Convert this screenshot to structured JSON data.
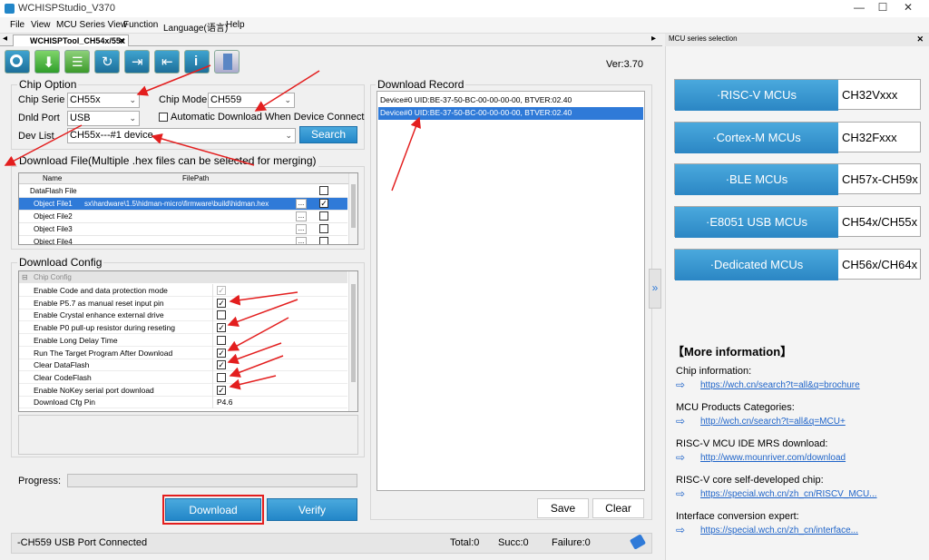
{
  "app": {
    "title": "WCHISPStudio_V370"
  },
  "window_controls": {
    "minimize": "—",
    "maximize": "☐",
    "close": "✕"
  },
  "menu": [
    "File",
    "View",
    "MCU Series View",
    "Function",
    "Language(语言)",
    "Help"
  ],
  "tabs": {
    "active": "WCHISPTool_CH54x/55x",
    "close": "✕",
    "nav_left": "◂",
    "nav_right": "▸"
  },
  "toolbar": {
    "icons": [
      "search-icon",
      "download-icon",
      "checklist-icon",
      "refresh-icon",
      "import-icon",
      "export-icon",
      "info-icon",
      "book-icon"
    ],
    "version": "Ver:3.70"
  },
  "chip_option": {
    "title": "Chip Option",
    "chip_serie_label": "Chip Serie",
    "chip_serie_value": "CH55x",
    "chip_model_label": "Chip Model",
    "chip_model_value": "CH559",
    "dnld_port_label": "Dnld Port",
    "dnld_port_value": "USB",
    "auto_download_label": "Automatic Download When Device Connect",
    "dev_list_label": "Dev List",
    "dev_list_value": "CH55x---#1 device",
    "search_button": "Search"
  },
  "download_file": {
    "title": "Download File(Multiple .hex files can be selected for merging)",
    "headers": [
      "Name",
      "FilePath"
    ],
    "rows": [
      {
        "name": "DataFlash File",
        "path": "",
        "checked": false,
        "browse": false,
        "selected": false
      },
      {
        "name": "Object File1",
        "path": "sx\\hardware\\1.5\\hidman-micro\\firmware\\build\\hidman.hex",
        "checked": true,
        "browse": true,
        "selected": true
      },
      {
        "name": "Object File2",
        "path": "",
        "checked": false,
        "browse": true,
        "selected": false
      },
      {
        "name": "Object File3",
        "path": "",
        "checked": false,
        "browse": true,
        "selected": false
      },
      {
        "name": "Object File4",
        "path": "",
        "checked": false,
        "browse": true,
        "selected": false
      }
    ],
    "browse_label": "..."
  },
  "download_config": {
    "title": "Download Config",
    "section": "Chip Config",
    "items": [
      {
        "label": "Enable Code and data protection mode",
        "value": "✓",
        "type": "check-disabled"
      },
      {
        "label": "Enable P5.7 as manual reset input pin",
        "value": "✓",
        "type": "check"
      },
      {
        "label": "Enable Crystal enhance external drive",
        "value": "",
        "type": "check"
      },
      {
        "label": "Enable P0 pull-up resistor during reseting",
        "value": "✓",
        "type": "check"
      },
      {
        "label": "Enable Long Delay Time",
        "value": "",
        "type": "check"
      },
      {
        "label": "Run The Target Program After Download",
        "value": "✓",
        "type": "check"
      },
      {
        "label": "Clear DataFlash",
        "value": "✓",
        "type": "check"
      },
      {
        "label": "Clear CodeFlash",
        "value": "",
        "type": "check"
      },
      {
        "label": "Enable NoKey serial port download",
        "value": "✓",
        "type": "check"
      },
      {
        "label": "Download Cfg Pin",
        "value": "P4.6",
        "type": "text"
      }
    ]
  },
  "progress": {
    "label": "Progress:",
    "percent": 0
  },
  "actions": {
    "download": "Download",
    "verify": "Verify"
  },
  "download_record": {
    "title": "Download Record",
    "lines": [
      {
        "text": "Device#0  UID:BE-37-50-BC-00-00-00-00, BTVER:02.40",
        "selected": false
      },
      {
        "text": "Device#0  UID:BE-37-50-BC-00-00-00-00, BTVER:02.40",
        "selected": true
      }
    ],
    "save": "Save",
    "clear": "Clear"
  },
  "status": {
    "device": "-CH559  USB Port  Connected",
    "total": "Total:0",
    "succ": "Succ:0",
    "failure": "Failure:0"
  },
  "series_panel": {
    "title": "MCU series selection",
    "close": "✕",
    "collapse": "»",
    "items": [
      {
        "name": "·RISC-V MCUs",
        "code": "CH32Vxxx"
      },
      {
        "name": "·Cortex-M MCUs",
        "code": "CH32Fxxx"
      },
      {
        "name": "·BLE MCUs",
        "code": "CH57x-CH59x"
      },
      {
        "name": "·E8051 USB MCUs",
        "code": "CH54x/CH55x"
      },
      {
        "name": "·Dedicated MCUs",
        "code": "CH56x/CH64x"
      }
    ],
    "more_title": "【More information】",
    "links": [
      {
        "label": "Chip information:",
        "url": "https://wch.cn/search?t=all&q=brochure"
      },
      {
        "label": "MCU Products Categories:",
        "url": "http://wch.cn/search?t=all&q=MCU+"
      },
      {
        "label": "RISC-V MCU IDE MRS download:",
        "url": "http://www.mounriver.com/download"
      },
      {
        "label": "RISC-V core self-developed chip:",
        "url": "https://special.wch.cn/zh_cn/RISCV_MCU..."
      },
      {
        "label": "Interface conversion expert:",
        "url": "https://special.wch.cn/zh_cn/interface..."
      }
    ]
  },
  "colors": {
    "accent": "#2286c8",
    "selection": "#2f7ad8",
    "annotation": "#e31e1e"
  }
}
